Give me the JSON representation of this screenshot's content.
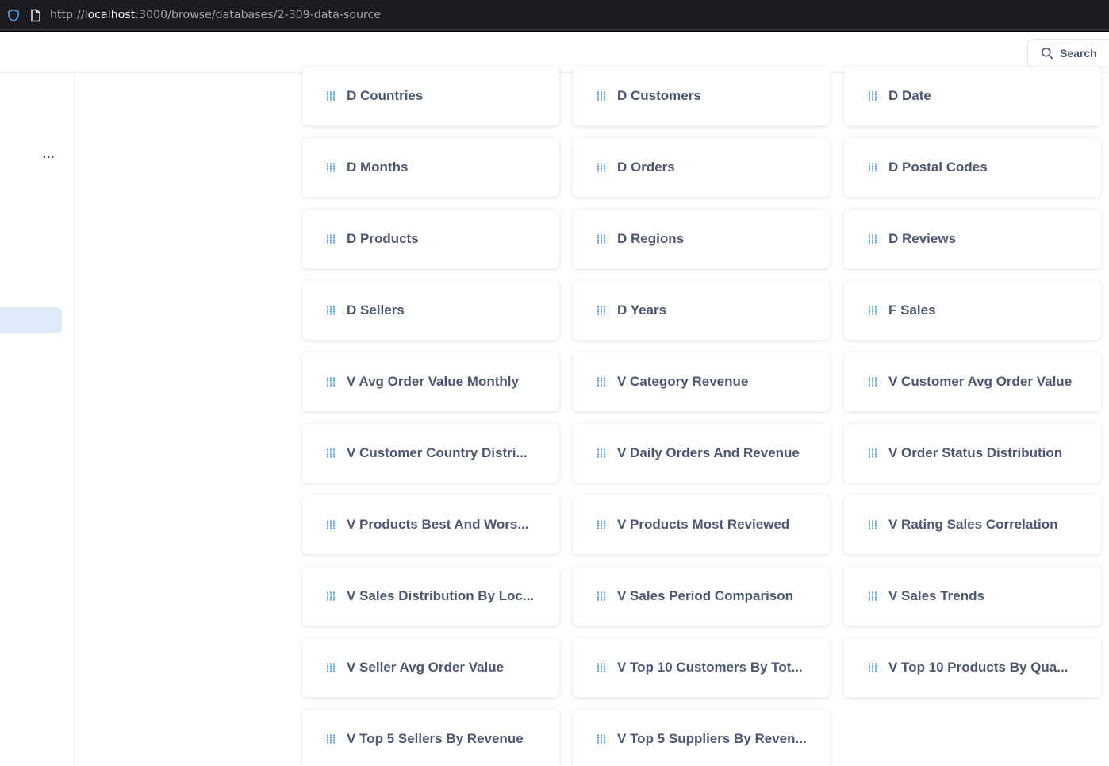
{
  "browser": {
    "url_prefix": "http://",
    "url_host": "localhost",
    "url_rest": ":3000/browse/databases/2-309-data-source"
  },
  "header": {
    "search_label": "Search"
  },
  "sidebar": {
    "more_label": "..."
  },
  "icons": {
    "table": "grid-icon",
    "search": "search-icon",
    "shield": "shield-icon",
    "page": "page-icon"
  },
  "colors": {
    "accent": "#509ee3",
    "text": "#4c5773",
    "active_bg": "#dfeaf8"
  },
  "tables": [
    "D Countries",
    "D Customers",
    "D Date",
    "D Months",
    "D Orders",
    "D Postal Codes",
    "D Products",
    "D Regions",
    "D Reviews",
    "D Sellers",
    "D Years",
    "F Sales",
    "V Avg Order Value Monthly",
    "V Category Revenue",
    "V Customer Avg Order Value",
    "V Customer Country Distri...",
    "V Daily Orders And Revenue",
    "V Order Status Distribution",
    "V Products Best And Wors...",
    "V Products Most Reviewed",
    "V Rating Sales Correlation",
    "V Sales Distribution By Loc...",
    "V Sales Period Comparison",
    "V Sales Trends",
    "V Seller Avg Order Value",
    "V Top 10 Customers By Tot...",
    "V Top 10 Products By Qua...",
    "V Top 5 Sellers By Revenue",
    "V Top 5 Suppliers By Reven..."
  ]
}
